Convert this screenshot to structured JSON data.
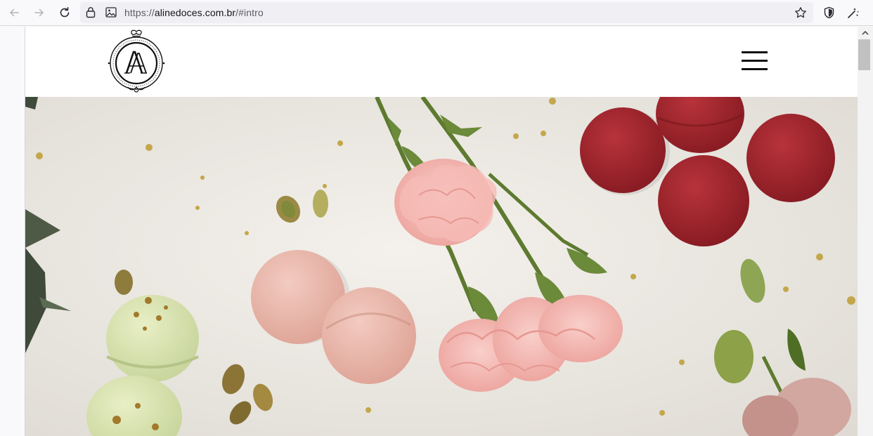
{
  "browser": {
    "url_scheme": "https://",
    "url_domain": "alinedoces.com.br",
    "url_path": "/#intro",
    "icons": [
      "back-arrow-icon",
      "forward-arrow-icon",
      "reload-icon",
      "lock-icon",
      "page-image-icon",
      "bookmark-star-icon",
      "shield-icon",
      "extensions-icon"
    ]
  },
  "site": {
    "logo_monogram": "A",
    "menu_icon": "hamburger-menu-icon"
  },
  "colors": {
    "macaron_red": "#a3232a",
    "macaron_pink": "#eab7ac",
    "macaron_green": "#dbe5b4",
    "carnation_pink": "#f4b6b1",
    "stem_green": "#5d7a2f",
    "tablecloth": "#ece8e2"
  }
}
